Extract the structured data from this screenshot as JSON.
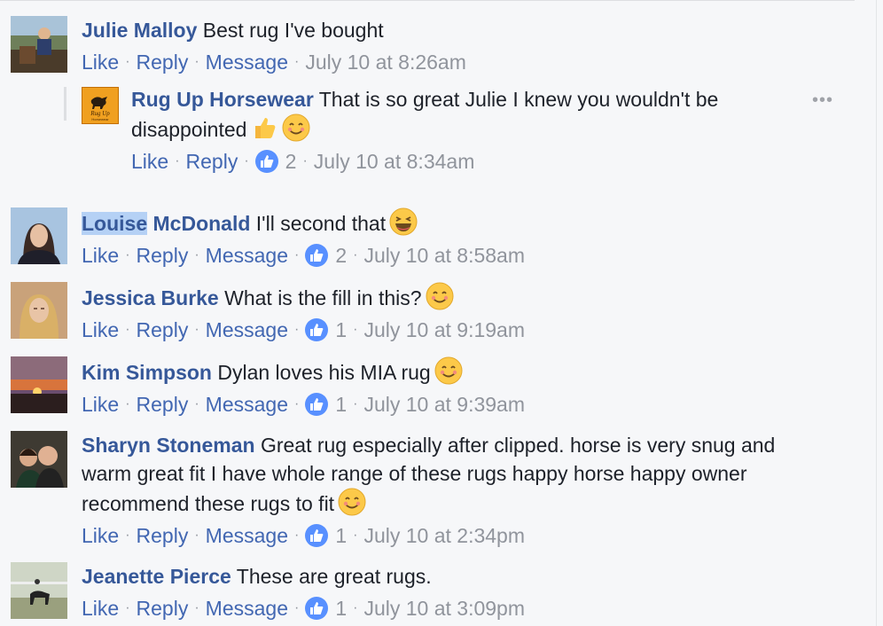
{
  "comments": [
    {
      "author": "Julie Malloy",
      "text": "Best rug I've bought",
      "like": "Like",
      "reply": "Reply",
      "message": "Message",
      "reactions": null,
      "time": "July 10 at 8:26am"
    },
    {
      "author": "Louise McDonald",
      "author_highlight": "Louise",
      "author_rest": " McDonald",
      "text": "I'll second that",
      "emoji": "laughing-emoji",
      "like": "Like",
      "reply": "Reply",
      "message": "Message",
      "reactions": "2",
      "time": "July 10 at 8:58am"
    },
    {
      "author": "Jessica Burke",
      "text": "What is the fill in this?",
      "emoji": "smile-emoji",
      "like": "Like",
      "reply": "Reply",
      "message": "Message",
      "reactions": "1",
      "time": "July 10 at 9:19am"
    },
    {
      "author": "Kim Simpson",
      "text": "Dylan loves his MIA rug",
      "emoji": "smile-emoji",
      "like": "Like",
      "reply": "Reply",
      "message": "Message",
      "reactions": "1",
      "time": "July 10 at 9:39am"
    },
    {
      "author": "Sharyn Stoneman",
      "text_lines": [
        "Great rug especially after clipped. horse is very snug and",
        "warm great fit I have whole range of these rugs happy horse happy owner",
        "recommend these rugs to fit"
      ],
      "emoji": "smile-emoji",
      "like": "Like",
      "reply": "Reply",
      "message": "Message",
      "reactions": "1",
      "time": "July 10 at 2:34pm"
    },
    {
      "author": "Jeanette Pierce",
      "text": "These are great rugs.",
      "like": "Like",
      "reply": "Reply",
      "message": "Message",
      "reactions": "1",
      "time": "July 10 at 3:09pm"
    }
  ],
  "reply": {
    "author": "Rug Up Horsewear",
    "text_lines": [
      "That is so great Julie I knew you wouldn't be",
      "disappointed"
    ],
    "emojis": [
      "thumbs-up-emoji",
      "smile-emoji"
    ],
    "logo_text": "Rug Up Horsewear",
    "like": "Like",
    "reply": "Reply",
    "reactions": "2",
    "time": "July 10 at 8:34am",
    "more": "•••"
  },
  "colors": {
    "link": "#4267b2",
    "author": "#365899",
    "meta": "#90949c",
    "like_badge": "#5890ff",
    "highlight": "#b5d1f5"
  }
}
